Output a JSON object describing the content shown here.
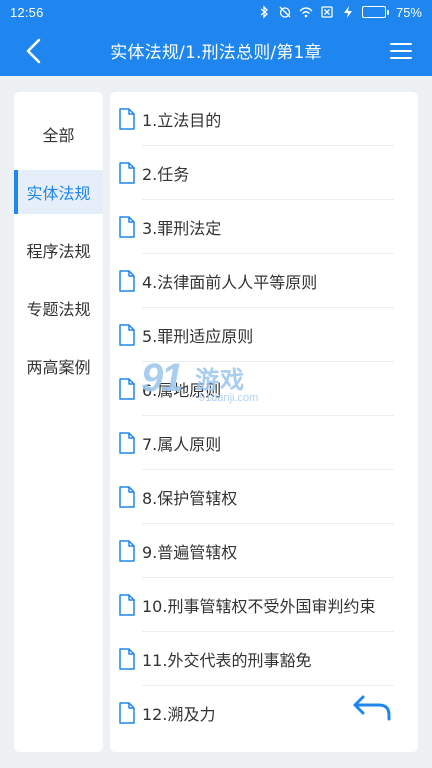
{
  "status_bar": {
    "time": "12:56",
    "battery_level": "75%",
    "battery_fraction": 0.75,
    "icons": [
      "bluetooth-icon",
      "alarm-off-icon",
      "wifi-icon",
      "sim-off-icon",
      "charging-icon"
    ]
  },
  "header": {
    "title": "实体法规/1.刑法总则/第1章",
    "back_icon": "back-chevron-icon",
    "menu_icon": "hamburger-menu-icon"
  },
  "sidebar": {
    "items": [
      {
        "label": "全部",
        "active": false
      },
      {
        "label": "实体法规",
        "active": true
      },
      {
        "label": "程序法规",
        "active": false
      },
      {
        "label": "专题法规",
        "active": false
      },
      {
        "label": "两高案例",
        "active": false
      }
    ]
  },
  "articles": {
    "items": [
      {
        "label": "1.立法目的"
      },
      {
        "label": "2.任务"
      },
      {
        "label": "3.罪刑法定"
      },
      {
        "label": "4.法律面前人人平等原则"
      },
      {
        "label": "5.罪刑适应原则"
      },
      {
        "label": "6.属地原则"
      },
      {
        "label": "7.属人原则"
      },
      {
        "label": "8.保护管辖权"
      },
      {
        "label": "9.普遍管辖权"
      },
      {
        "label": "10.刑事管辖权不受外国审判约束"
      },
      {
        "label": "11.外交代表的刑事豁免"
      },
      {
        "label": "12.溯及力"
      }
    ]
  },
  "watermark": {
    "logo": "91",
    "title": "游戏",
    "site": "91danji.com"
  },
  "colors": {
    "primary": "#1e86ee",
    "background": "#eef1f4",
    "text": "#333333",
    "active_bg": "#e6eef9"
  }
}
